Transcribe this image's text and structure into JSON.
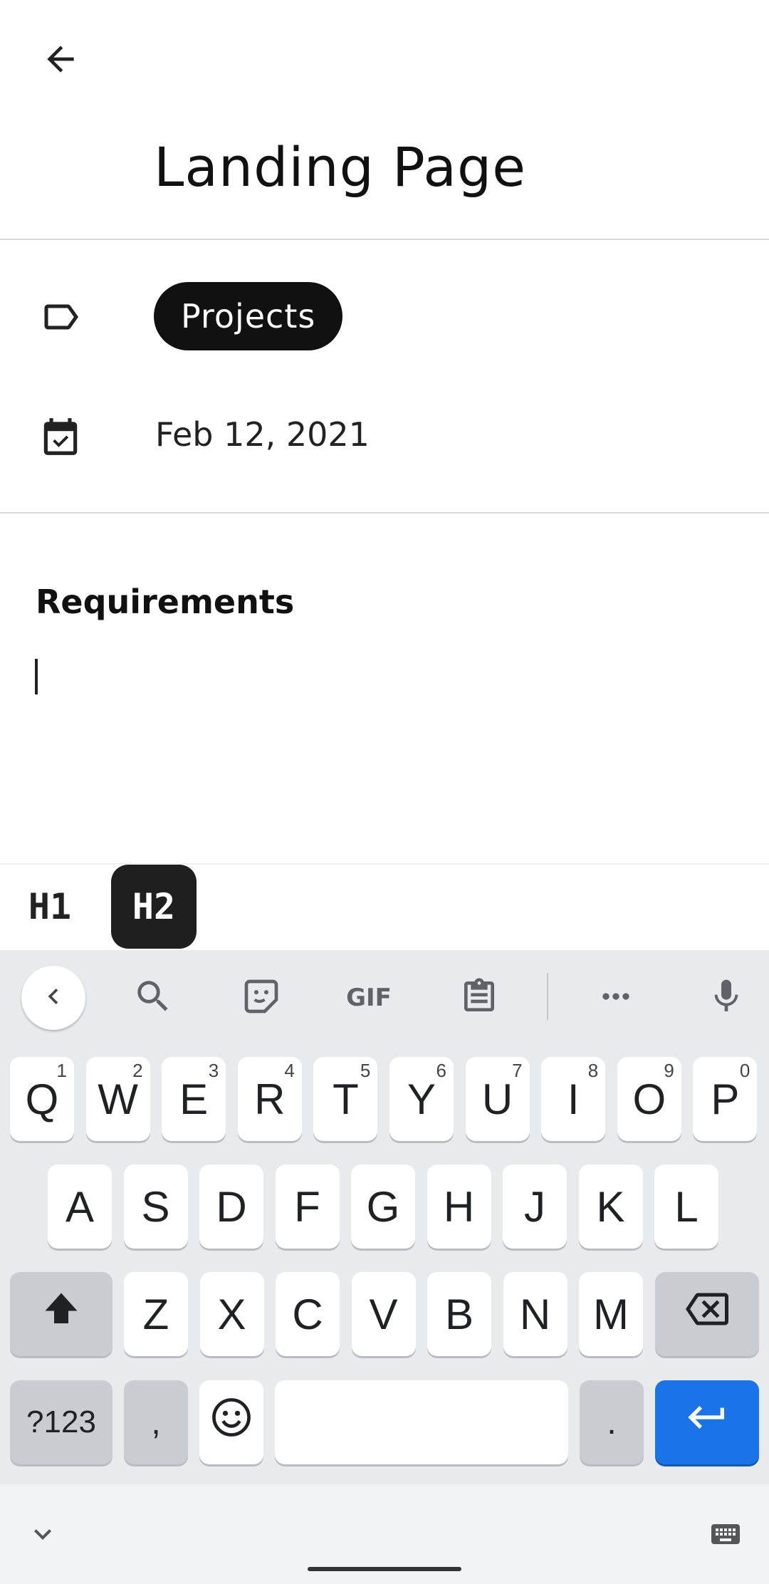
{
  "header": {
    "title": "Landing Page"
  },
  "meta": {
    "tag": "Projects",
    "date": "Feb 12, 2021"
  },
  "editor": {
    "heading": "Requirements"
  },
  "format_bar": {
    "h1_label": "H1",
    "h2_label": "H2",
    "active": "H2"
  },
  "keyboard": {
    "toolbar": {
      "gif_label": "GIF"
    },
    "row1": [
      {
        "label": "Q",
        "hint": "1"
      },
      {
        "label": "W",
        "hint": "2"
      },
      {
        "label": "E",
        "hint": "3"
      },
      {
        "label": "R",
        "hint": "4"
      },
      {
        "label": "T",
        "hint": "5"
      },
      {
        "label": "Y",
        "hint": "6"
      },
      {
        "label": "U",
        "hint": "7"
      },
      {
        "label": "I",
        "hint": "8"
      },
      {
        "label": "O",
        "hint": "9"
      },
      {
        "label": "P",
        "hint": "0"
      }
    ],
    "row2": [
      "A",
      "S",
      "D",
      "F",
      "G",
      "H",
      "J",
      "K",
      "L"
    ],
    "row3": [
      "Z",
      "X",
      "C",
      "V",
      "B",
      "N",
      "M"
    ],
    "symbols_label": "?123",
    "comma_label": ",",
    "period_label": ".",
    "accent_color": "#1a73e8"
  }
}
